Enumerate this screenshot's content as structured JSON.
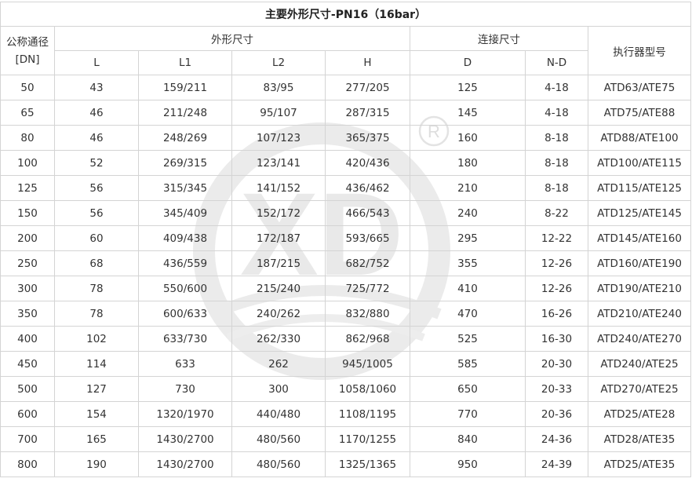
{
  "title": "主要外形尺寸-PN16（16bar）",
  "headers": {
    "dn": "公称通径",
    "dn_unit": "[DN]",
    "outline_group": "外形尺寸",
    "connect_group": "连接尺寸",
    "actuator": "执行器型号",
    "L": "L",
    "L1": "L1",
    "L2": "L2",
    "H": "H",
    "D": "D",
    "ND": "N-D"
  },
  "rows": [
    {
      "dn": "50",
      "L": "43",
      "L1": "159/211",
      "L2": "83/95",
      "H": "277/205",
      "D": "125",
      "ND": "4-18",
      "actuator": "ATD63/ATE75"
    },
    {
      "dn": "65",
      "L": "46",
      "L1": "211/248",
      "L2": "95/107",
      "H": "287/315",
      "D": "145",
      "ND": "4-18",
      "actuator": "ATD75/ATE88"
    },
    {
      "dn": "80",
      "L": "46",
      "L1": "248/269",
      "L2": "107/123",
      "H": "365/375",
      "D": "160",
      "ND": "8-18",
      "actuator": "ATD88/ATE100"
    },
    {
      "dn": "100",
      "L": "52",
      "L1": "269/315",
      "L2": "123/141",
      "H": "420/436",
      "D": "180",
      "ND": "8-18",
      "actuator": "ATD100/ATE115"
    },
    {
      "dn": "125",
      "L": "56",
      "L1": "315/345",
      "L2": "141/152",
      "H": "436/462",
      "D": "210",
      "ND": "8-18",
      "actuator": "ATD115/ATE125"
    },
    {
      "dn": "150",
      "L": "56",
      "L1": "345/409",
      "L2": "152/172",
      "H": "466/543",
      "D": "240",
      "ND": "8-22",
      "actuator": "ATD125/ATE145"
    },
    {
      "dn": "200",
      "L": "60",
      "L1": "409/438",
      "L2": "172/187",
      "H": "593/665",
      "D": "295",
      "ND": "12-22",
      "actuator": "ATD145/ATE160"
    },
    {
      "dn": "250",
      "L": "68",
      "L1": "436/559",
      "L2": "187/215",
      "H": "682/752",
      "D": "355",
      "ND": "12-26",
      "actuator": "ATD160/ATE190"
    },
    {
      "dn": "300",
      "L": "78",
      "L1": "550/600",
      "L2": "215/240",
      "H": "725/772",
      "D": "410",
      "ND": "12-26",
      "actuator": "ATD190/ATE210"
    },
    {
      "dn": "350",
      "L": "78",
      "L1": "600/633",
      "L2": "240/262",
      "H": "832/880",
      "D": "470",
      "ND": "16-26",
      "actuator": "ATD210/ATE240"
    },
    {
      "dn": "400",
      "L": "102",
      "L1": "633/730",
      "L2": "262/330",
      "H": "862/968",
      "D": "525",
      "ND": "16-30",
      "actuator": "ATD240/ATE270"
    },
    {
      "dn": "450",
      "L": "114",
      "L1": "633",
      "L2": "262",
      "H": "945/1005",
      "D": "585",
      "ND": "20-30",
      "actuator": "ATD240/ATE25"
    },
    {
      "dn": "500",
      "L": "127",
      "L1": "730",
      "L2": "300",
      "H": "1058/1060",
      "D": "650",
      "ND": "20-33",
      "actuator": "ATD270/ATE25"
    },
    {
      "dn": "600",
      "L": "154",
      "L1": "1320/1970",
      "L2": "440/480",
      "H": "1108/1195",
      "D": "770",
      "ND": "20-36",
      "actuator": "ATD25/ATE28"
    },
    {
      "dn": "700",
      "L": "165",
      "L1": "1430/2700",
      "L2": "480/560",
      "H": "1170/1255",
      "D": "840",
      "ND": "24-36",
      "actuator": "ATD28/ATE35"
    },
    {
      "dn": "800",
      "L": "190",
      "L1": "1430/2700",
      "L2": "480/560",
      "H": "1325/1365",
      "D": "950",
      "ND": "24-39",
      "actuator": "ATD25/ATE35"
    }
  ],
  "watermark": {
    "text": "XD",
    "mark": "®",
    "color": "#e6e6e6"
  }
}
